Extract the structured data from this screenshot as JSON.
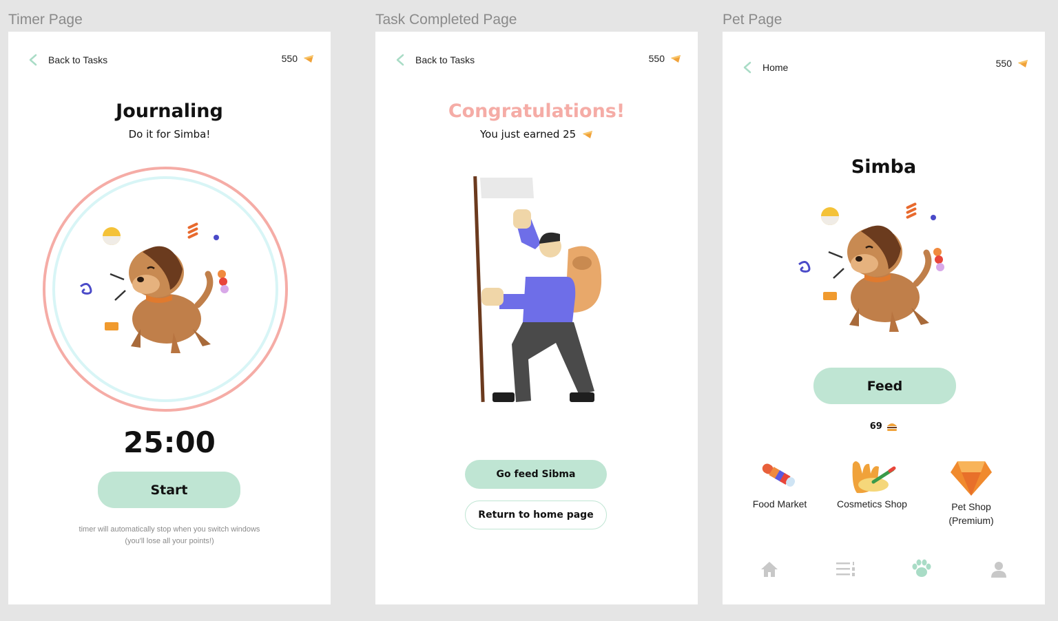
{
  "frames": {
    "timer": {
      "label": "Timer Page",
      "back_label": "Back to Tasks",
      "coins": "550",
      "task_title": "Journaling",
      "subtitle": "Do it for Simba!",
      "time": "25:00",
      "start_label": "Start",
      "note_line1": "timer will automatically stop when you switch windows",
      "note_line2": "(you'll lose all your points!)"
    },
    "completed": {
      "label": "Task Completed Page",
      "back_label": "Back to Tasks",
      "coins": "550",
      "heading": "Congratulations!",
      "earned_text": "You just earned 25",
      "feed_button": "Go feed Sibma",
      "home_button": "Return to home page"
    },
    "pet": {
      "label": "Pet Page",
      "back_label": "Home",
      "coins": "550",
      "pet_name": "Simba",
      "feed_label": "Feed",
      "food_count": "69",
      "shops": [
        {
          "label": "Food Market",
          "icon": "candy-icon"
        },
        {
          "label": "Cosmetics Shop",
          "icon": "cosmetics-glove-icon"
        },
        {
          "label": "Pet Shop",
          "label2": "(Premium)",
          "icon": "gem-icon"
        }
      ],
      "nav": [
        "home-icon",
        "list-icon",
        "paw-icon",
        "user-icon"
      ]
    }
  },
  "colors": {
    "mint": "#bfe5d3",
    "accent_pink": "#f5aca6",
    "ring_cyan": "#d8f5f6",
    "nav_active": "#a9dcc6",
    "nav_inactive": "#c8c8c8"
  }
}
